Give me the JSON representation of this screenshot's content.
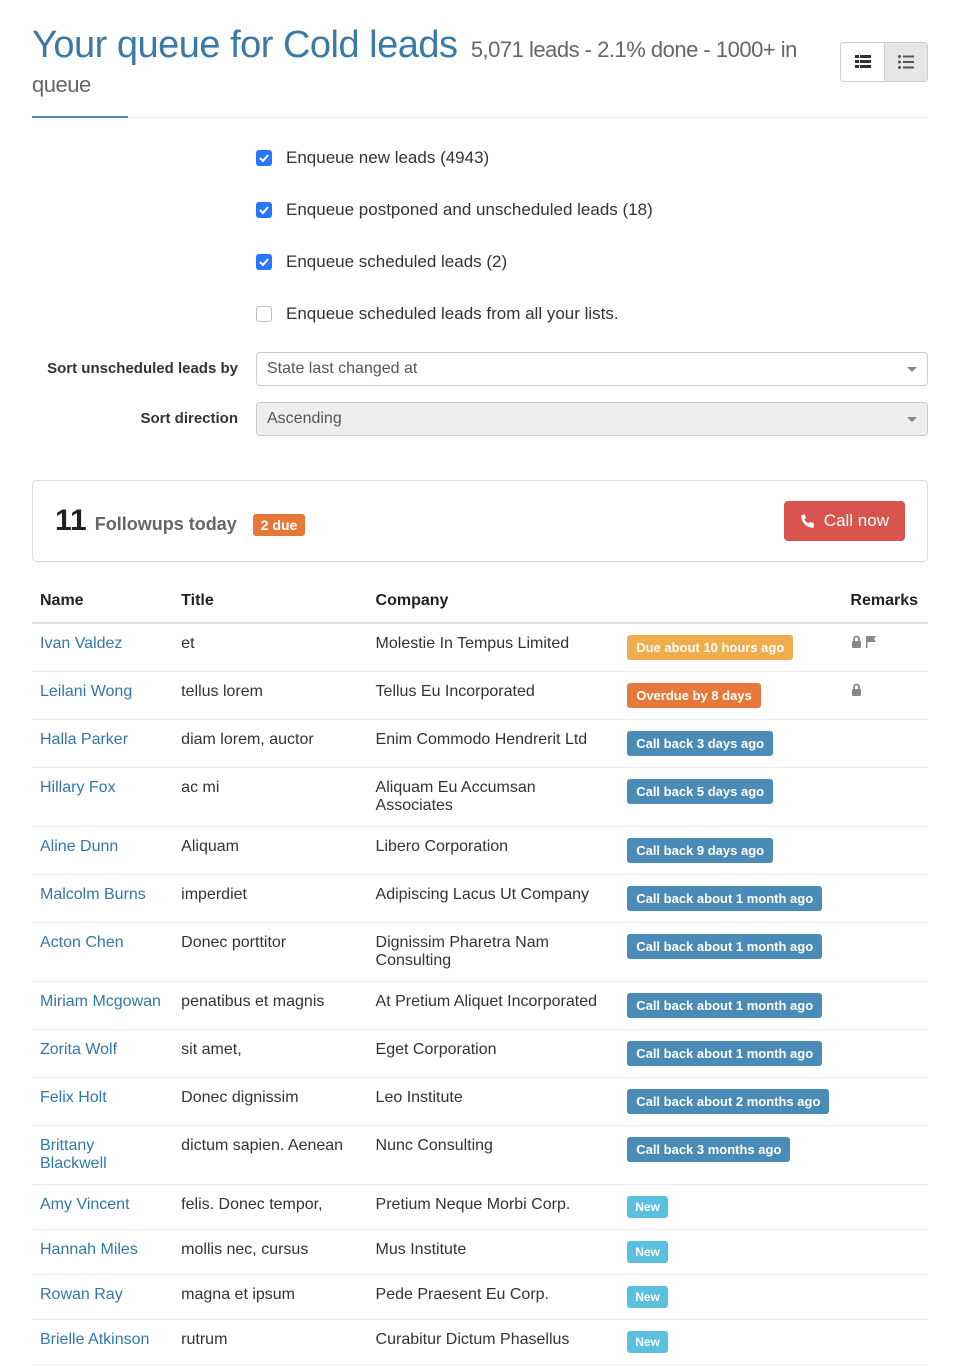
{
  "header": {
    "title_prefix": "Your queue for ",
    "queue_name": "Cold leads",
    "subtitle": "5,071 leads - 2.1% done - 1000+ in queue"
  },
  "checkboxes": [
    {
      "label": "Enqueue new leads (4943)",
      "checked": true
    },
    {
      "label": "Enqueue postponed and unscheduled leads (18)",
      "checked": true
    },
    {
      "label": "Enqueue scheduled leads (2)",
      "checked": true
    },
    {
      "label": "Enqueue scheduled leads from all your lists.",
      "checked": false
    }
  ],
  "sort": {
    "label_unscheduled": "Sort unscheduled leads by",
    "value_unscheduled": "State last changed at",
    "label_direction": "Sort direction",
    "value_direction": "Ascending"
  },
  "followups": {
    "count": "11",
    "text": "Followups today",
    "due_badge": "2 due",
    "call_now": "Call now"
  },
  "columns": {
    "name": "Name",
    "title": "Title",
    "company": "Company",
    "remarks": "Remarks"
  },
  "badge_colors": {
    "due": "badge-due",
    "overdue": "badge-overdue",
    "callback": "badge-callback",
    "new": "badge-new"
  },
  "leads": [
    {
      "name": "Ivan Valdez",
      "title": "et",
      "company": "Molestie In Tempus Limited",
      "status": "Due about 10 hours ago",
      "status_type": "due",
      "remarks": [
        "lock",
        "flag"
      ]
    },
    {
      "name": "Leilani Wong",
      "title": "tellus lorem",
      "company": "Tellus Eu Incorporated",
      "status": "Overdue by 8 days",
      "status_type": "overdue",
      "remarks": [
        "lock"
      ]
    },
    {
      "name": "Halla Parker",
      "title": "diam lorem, auctor",
      "company": "Enim Commodo Hendrerit Ltd",
      "status": "Call back 3 days ago",
      "status_type": "callback",
      "remarks": []
    },
    {
      "name": "Hillary Fox",
      "title": "ac mi",
      "company": "Aliquam Eu Accumsan Associates",
      "status": "Call back 5 days ago",
      "status_type": "callback",
      "remarks": []
    },
    {
      "name": "Aline Dunn",
      "title": "Aliquam",
      "company": "Libero Corporation",
      "status": "Call back 9 days ago",
      "status_type": "callback",
      "remarks": []
    },
    {
      "name": "Malcolm Burns",
      "title": "imperdiet",
      "company": "Adipiscing Lacus Ut Company",
      "status": "Call back about 1 month ago",
      "status_type": "callback",
      "remarks": []
    },
    {
      "name": "Acton Chen",
      "title": "Donec porttitor",
      "company": "Dignissim Pharetra Nam Consulting",
      "status": "Call back about 1 month ago",
      "status_type": "callback",
      "remarks": []
    },
    {
      "name": "Miriam Mcgowan",
      "title": "penatibus et magnis",
      "company": "At Pretium Aliquet Incorporated",
      "status": "Call back about 1 month ago",
      "status_type": "callback",
      "remarks": []
    },
    {
      "name": "Zorita Wolf",
      "title": "sit amet,",
      "company": "Eget Corporation",
      "status": "Call back about 1 month ago",
      "status_type": "callback",
      "remarks": []
    },
    {
      "name": "Felix Holt",
      "title": "Donec dignissim",
      "company": "Leo Institute",
      "status": "Call back about 2 months ago",
      "status_type": "callback",
      "remarks": []
    },
    {
      "name": "Brittany Blackwell",
      "title": "dictum sapien. Aenean",
      "company": "Nunc Consulting",
      "status": "Call back 3 months ago",
      "status_type": "callback",
      "remarks": []
    },
    {
      "name": "Amy Vincent",
      "title": "felis. Donec tempor,",
      "company": "Pretium Neque Morbi Corp.",
      "status": "New",
      "status_type": "new",
      "remarks": []
    },
    {
      "name": "Hannah Miles",
      "title": "mollis nec, cursus",
      "company": "Mus Institute",
      "status": "New",
      "status_type": "new",
      "remarks": []
    },
    {
      "name": "Rowan Ray",
      "title": "magna et ipsum",
      "company": "Pede Praesent Eu Corp.",
      "status": "New",
      "status_type": "new",
      "remarks": []
    },
    {
      "name": "Brielle Atkinson",
      "title": "rutrum",
      "company": "Curabitur Dictum Phasellus",
      "status": "New",
      "status_type": "new",
      "remarks": []
    }
  ]
}
